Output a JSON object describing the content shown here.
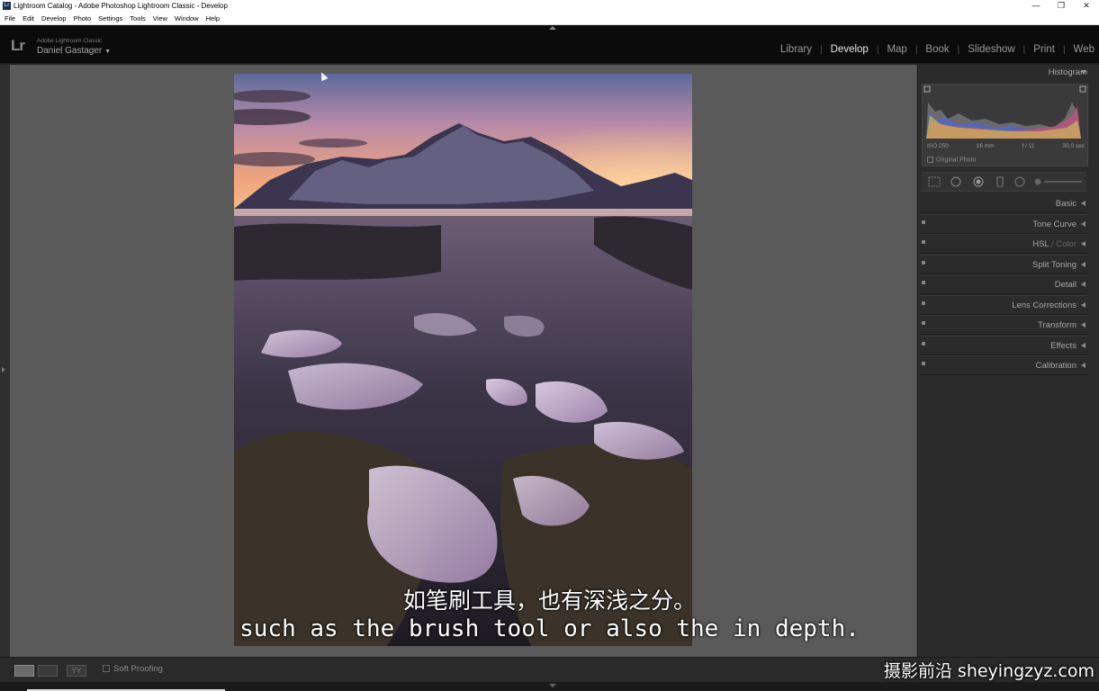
{
  "window": {
    "title": "Lightroom Catalog - Adobe Photoshop Lightroom Classic - Develop",
    "app_icon": "Lr",
    "buttons": {
      "minimize": "—",
      "restore": "❐",
      "close": "✕"
    }
  },
  "menu": {
    "items": [
      "File",
      "Edit",
      "Develop",
      "Photo",
      "Settings",
      "Tools",
      "View",
      "Window",
      "Help"
    ]
  },
  "identity": {
    "logo": "Lr",
    "product": "Adobe Lightroom Classic",
    "user": "Daniel Gastager",
    "caret": "▼"
  },
  "modules": {
    "items": [
      "Library",
      "Develop",
      "Map",
      "Book",
      "Slideshow",
      "Print",
      "Web"
    ],
    "active": "Develop",
    "separator": "|"
  },
  "histogram": {
    "label": "Histogram",
    "iso": "ISO 250",
    "focal": "16 mm",
    "aperture": "f / 11",
    "shutter": "30,0 sec",
    "original_photo": "Original Photo"
  },
  "panels": {
    "sections": [
      {
        "label": "Basic",
        "switch": false
      },
      {
        "label": "Tone Curve",
        "switch": true
      },
      {
        "label": "HSL",
        "label_dim": " / Color",
        "switch": true
      },
      {
        "label": "Split Toning",
        "switch": true
      },
      {
        "label": "Detail",
        "switch": true
      },
      {
        "label": "Lens Corrections",
        "switch": true
      },
      {
        "label": "Transform",
        "switch": true
      },
      {
        "label": "Effects",
        "switch": true
      },
      {
        "label": "Calibration",
        "switch": true
      }
    ]
  },
  "toolbar": {
    "soft_proofing": "Soft Proofing",
    "view_yy": "YY"
  },
  "subtitles": {
    "chinese": "如笔刷工具，也有深浅之分。",
    "english": "such as the brush tool or also the in depth."
  },
  "watermark": "摄影前沿 sheyingzyz.com",
  "colors": {
    "accent_active": "#e8e8e8",
    "panel_bg": "#2b2b2b",
    "canvas_bg": "#5a5a5a"
  }
}
